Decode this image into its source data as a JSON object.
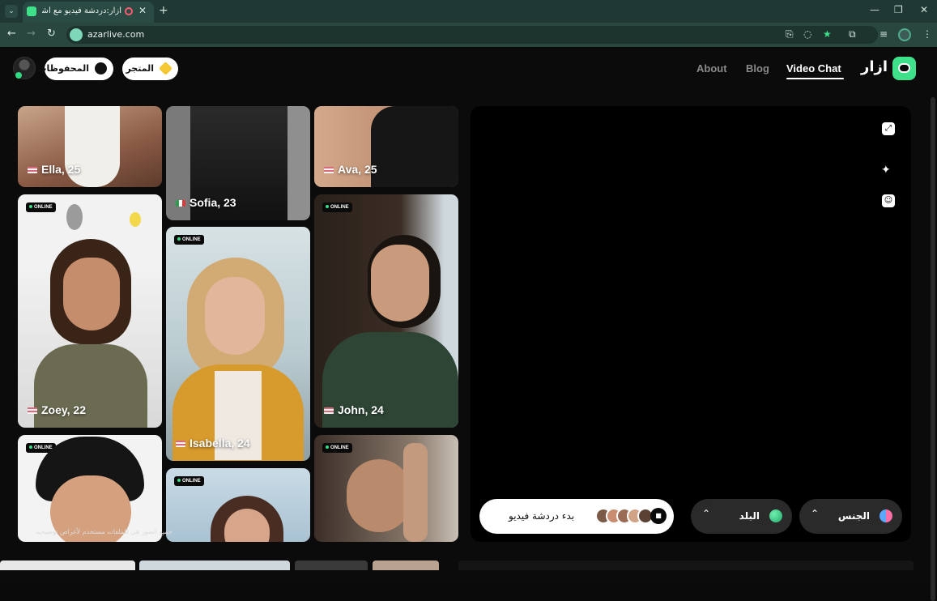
{
  "browser": {
    "tab_title": "أزار:دردشة فيديو مع أشخاص",
    "url": "azarlive.com",
    "new_tab": "+",
    "close": "✕"
  },
  "header": {
    "logo_text": "ازار",
    "nav": [
      {
        "label": "Video Chat",
        "active": true
      },
      {
        "label": "Blog"
      },
      {
        "label": "About"
      }
    ],
    "store_label": "المتجر",
    "saved_label": "المحفوظات"
  },
  "grid": {
    "online_badge": "ONLINE",
    "cards": [
      {
        "name": "Ella, 25",
        "flag": "us"
      },
      {
        "name": "Sofia, 23",
        "flag": "it"
      },
      {
        "name": "Ava, 25",
        "flag": "us"
      },
      {
        "name": "Zoey, 22",
        "flag": "us"
      },
      {
        "name": "Isabella, 24",
        "flag": "us"
      },
      {
        "name": "John, 24",
        "flag": "us"
      },
      {
        "name": "",
        "flag": ""
      },
      {
        "name": "",
        "flag": ""
      },
      {
        "name": "",
        "flag": ""
      }
    ],
    "bottom_caption": "جميع الصور هي للملفات مستخدم لأغراض توضيحية"
  },
  "video_panel": {
    "start_label": "بدء دردشة فيديو",
    "country_label": "البلد",
    "gender_label": "الجنس"
  },
  "colors": {
    "accent": "#3ee08a",
    "background": "#0b0b0b",
    "panel": "#000000",
    "selector_bg": "#2a2a2a"
  }
}
